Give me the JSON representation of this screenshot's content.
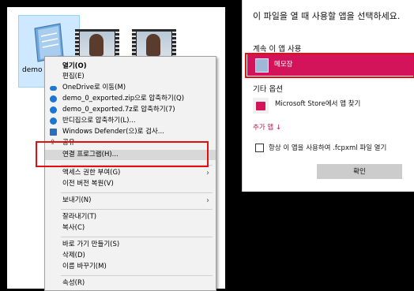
{
  "desktop": {
    "file_label": "demo"
  },
  "context_menu": {
    "items": [
      {
        "label": "열기(O)"
      },
      {
        "label": "편집(E)"
      },
      {
        "label": "OneDrive로 이동(M)"
      },
      {
        "label": "demo_0_exported.zip으로 압축하기(Q)"
      },
      {
        "label": "demo_0_exported.7z로 압축하기(7)"
      },
      {
        "label": "반디집으로 압축하기(L)..."
      },
      {
        "label": "Windows Defender(으)로 검사..."
      },
      {
        "label": "공유"
      },
      {
        "label": "연결 프로그램(H)..."
      },
      {
        "label": "액세스 권한 부여(G)"
      },
      {
        "label": "이전 버전 복원(V)"
      },
      {
        "label": "보내기(N)"
      },
      {
        "label": "잘라내기(T)"
      },
      {
        "label": "복사(C)"
      },
      {
        "label": "바로 가기 만들기(S)"
      },
      {
        "label": "삭제(D)"
      },
      {
        "label": "이름 바꾸기(M)"
      },
      {
        "label": "속성(R)"
      }
    ]
  },
  "dialog": {
    "title": "이 파일을 열 때 사용할 앱을 선택하세요.",
    "keep_using_heading": "계속 이 앱 사용",
    "current_app": "메모장",
    "other_options_heading": "기타 옵션",
    "store_app": "Microsoft Store에서 앱 찾기",
    "more_apps": "추가 앱 ↓",
    "always_use_label": "항상 이 앱을 사용하여 .fcpxml 파일 열기",
    "ok_label": "확인"
  },
  "colors": {
    "accent": "#d4145a",
    "highlight_box": "#e01010"
  }
}
